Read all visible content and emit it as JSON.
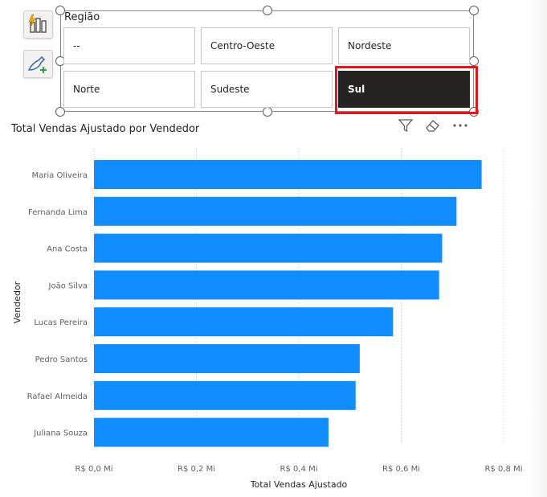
{
  "slicer": {
    "title": "Região",
    "items": [
      {
        "label": "--",
        "selected": false
      },
      {
        "label": "Centro-Oeste",
        "selected": false
      },
      {
        "label": "Nordeste",
        "selected": false
      },
      {
        "label": "Norte",
        "selected": false
      },
      {
        "label": "Sudeste",
        "selected": false
      },
      {
        "label": "Sul",
        "selected": true
      }
    ]
  },
  "tools": {
    "icons": [
      "format-visual-icon",
      "analytics-brush-icon"
    ]
  },
  "header_icons": [
    "filter-icon",
    "eraser-icon",
    "more-options-icon"
  ],
  "colors": {
    "bar": "#118dff",
    "selected_tile": "#252423",
    "highlight_border": "#e3161e",
    "grid": "#c8c6c4"
  },
  "chart_data": {
    "type": "bar",
    "orientation": "horizontal",
    "title": "Total Vendas Ajustado por Vendedor",
    "xlabel": "Total Vendas Ajustado",
    "ylabel": "Vendedor",
    "categories": [
      "Maria Oliveira",
      "Fernanda Lima",
      "Ana Costa",
      "João Silva",
      "Lucas Pereira",
      "Pedro Santos",
      "Rafael Almeida",
      "Juliana Souza"
    ],
    "values": [
      0.757,
      0.708,
      0.68,
      0.674,
      0.584,
      0.519,
      0.511,
      0.458
    ],
    "unit": "Mi",
    "xlim": [
      0,
      0.8
    ],
    "xticks": [
      0,
      0.2,
      0.4,
      0.6,
      0.8
    ],
    "xtick_labels": [
      "R$ 0,0 Mi",
      "R$ 0,2 Mi",
      "R$ 0,4 Mi",
      "R$ 0,6 Mi",
      "R$ 0,8 Mi"
    ],
    "grid": true
  }
}
